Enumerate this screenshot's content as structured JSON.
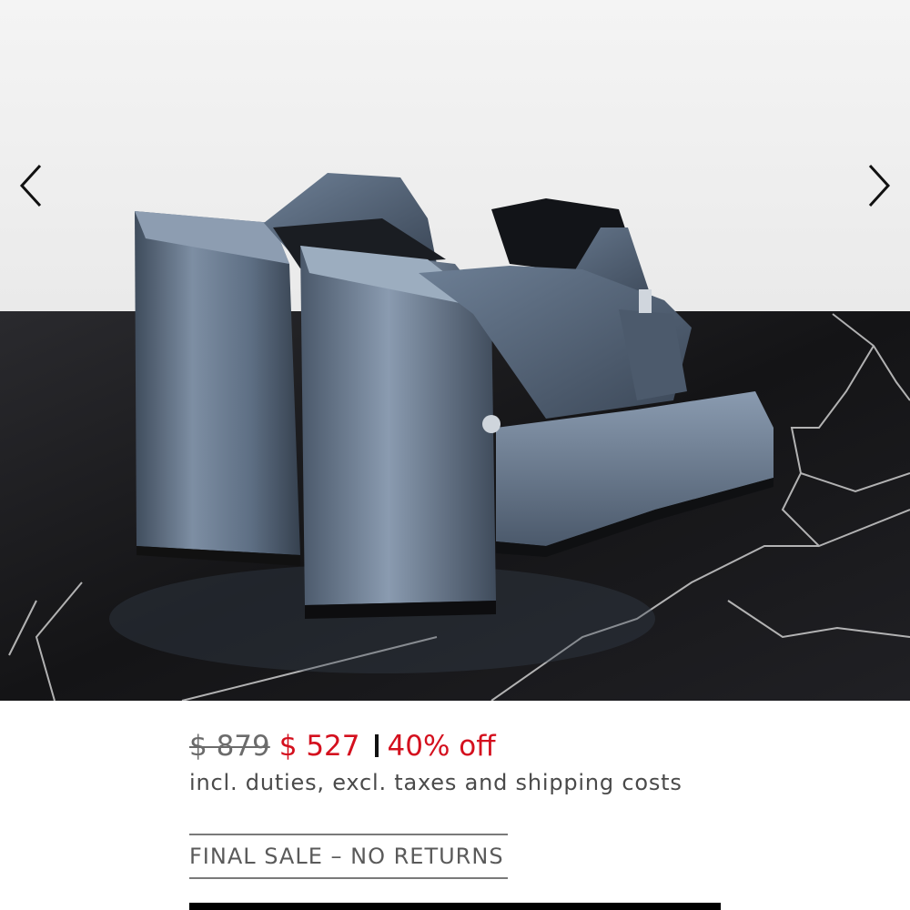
{
  "gallery": {
    "image_alt": "Metallic blue platform mule sandals",
    "prev_icon": "chevron-left-icon",
    "next_icon": "chevron-right-icon"
  },
  "pricing": {
    "original_price": "$ 879",
    "sale_price": "$ 527",
    "discount": "40% off",
    "tax_note": "incl. duties, excl. taxes and shipping costs"
  },
  "notice": {
    "final_sale": "FINAL SALE – NO RETURNS"
  },
  "colors": {
    "sale_red": "#d4101e",
    "shoe_blue": "#5b6c82",
    "marble_black": "#1a1a1c"
  }
}
